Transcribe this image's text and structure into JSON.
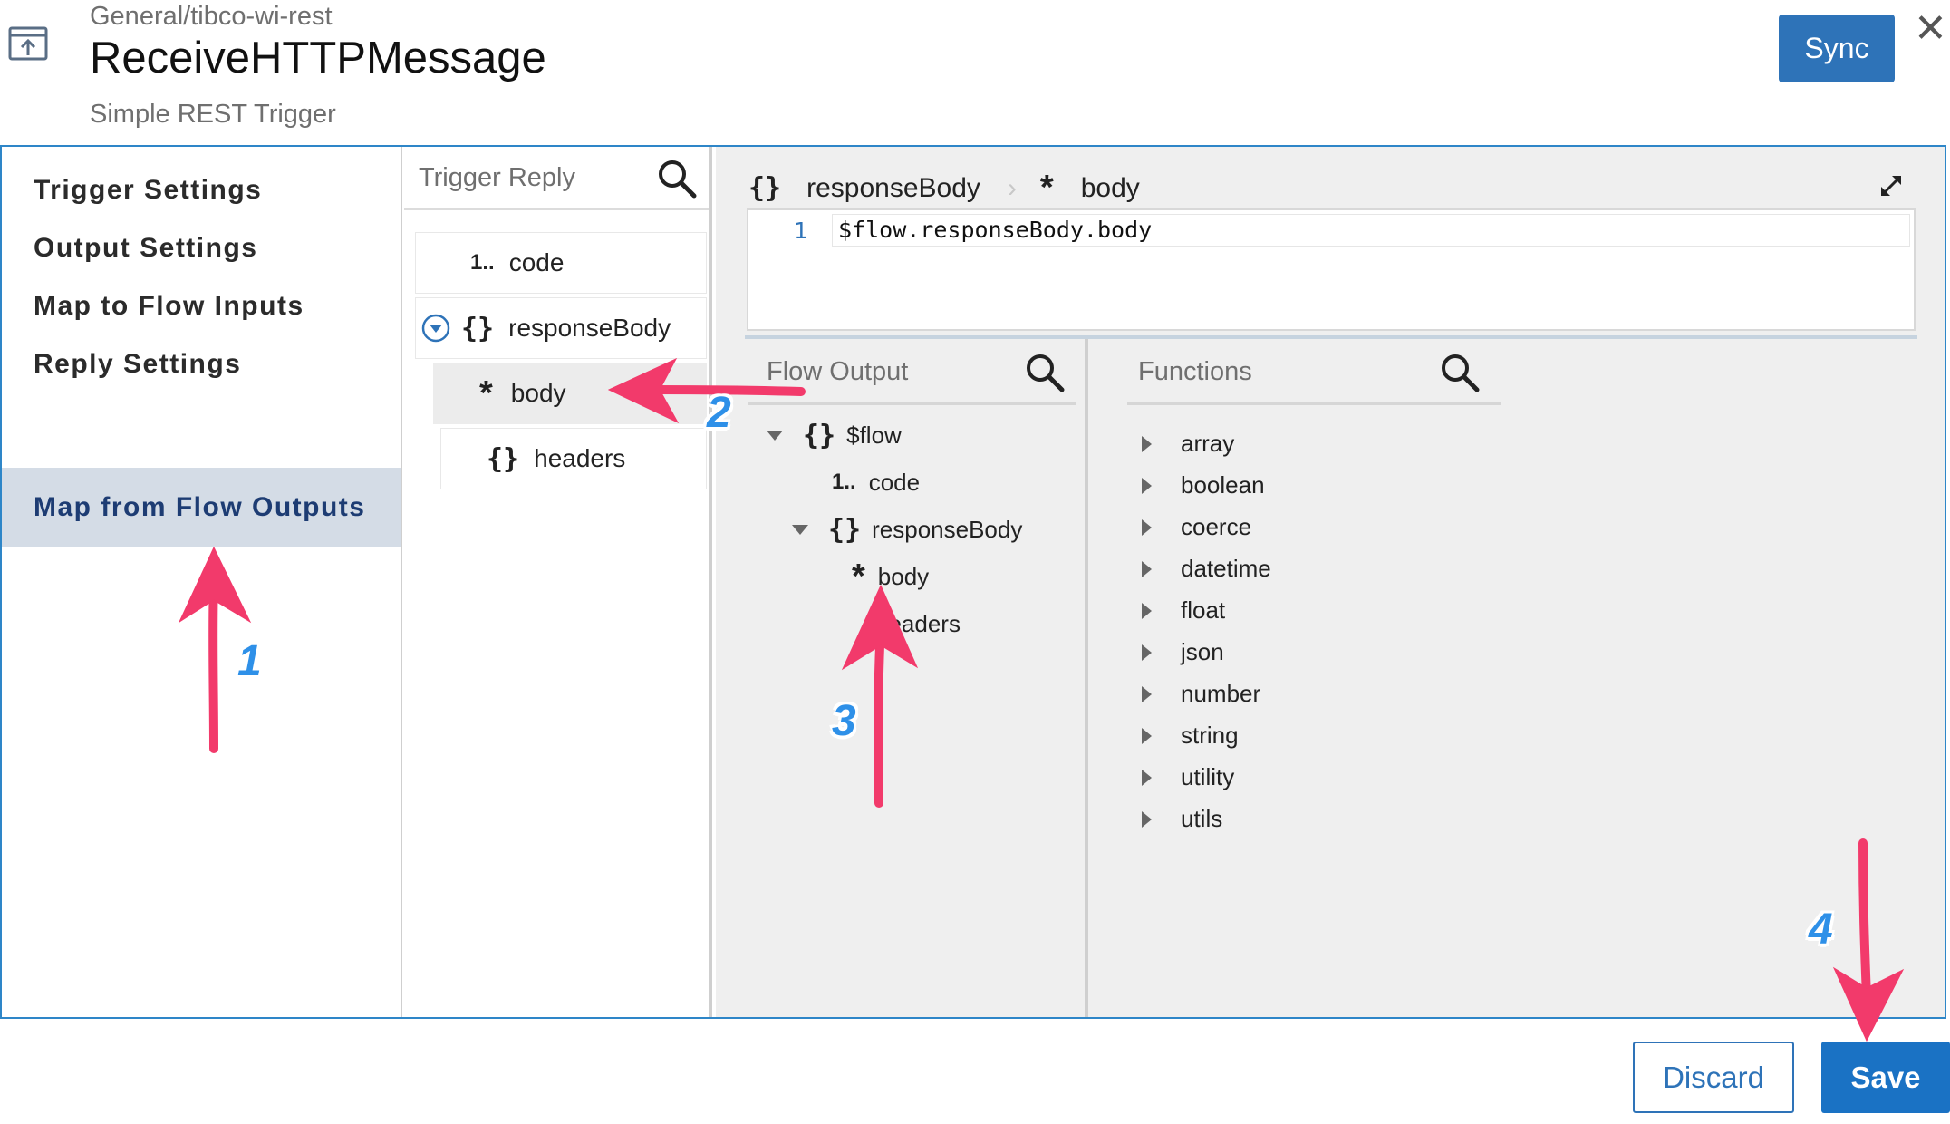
{
  "header": {
    "breadcrumb": "General/tibco-wi-rest",
    "title": "ReceiveHTTPMessage",
    "subtitle": "Simple REST Trigger",
    "sync_label": "Sync",
    "close_label": "✕",
    "icon": "trigger-icon"
  },
  "nav": {
    "items": [
      {
        "label": "Trigger Settings",
        "active": false
      },
      {
        "label": "Output Settings",
        "active": false
      },
      {
        "label": "Map to Flow Inputs",
        "active": false
      },
      {
        "label": "Reply Settings",
        "active": false
      },
      {
        "label": "Map from Flow Outputs",
        "active": true
      }
    ]
  },
  "trigger_reply": {
    "title": "Trigger Reply",
    "items": [
      {
        "icon": "1..",
        "label": "code",
        "type": "number"
      },
      {
        "icon": "{}",
        "label": "responseBody",
        "type": "object",
        "expanded": true
      },
      {
        "icon": "*",
        "label": "body",
        "type": "any",
        "selected": true
      },
      {
        "icon": "{}",
        "label": "headers",
        "type": "object"
      }
    ]
  },
  "mapper": {
    "path": [
      {
        "icon": "{}",
        "label": "responseBody"
      },
      {
        "icon": "*",
        "label": "body"
      }
    ],
    "path_separator": "›",
    "line_number": "1",
    "expression": "$flow.responseBody.body"
  },
  "flow_output": {
    "title": "Flow Output",
    "items": [
      {
        "icon": "{}",
        "label": "$flow",
        "expanded": true
      },
      {
        "icon": "1..",
        "label": "code"
      },
      {
        "icon": "{}",
        "label": "responseBody",
        "expanded": true
      },
      {
        "icon": "*",
        "label": "body"
      },
      {
        "icon": "",
        "label": "headers"
      }
    ]
  },
  "functions": {
    "title": "Functions",
    "items": [
      "array",
      "boolean",
      "coerce",
      "datetime",
      "float",
      "json",
      "number",
      "string",
      "utility",
      "utils"
    ]
  },
  "footer": {
    "discard_label": "Discard",
    "save_label": "Save"
  },
  "annotations": {
    "labels": [
      "1",
      "2",
      "3",
      "4"
    ],
    "color": "#f23a6b"
  },
  "colors": {
    "accent": "#2e73b8",
    "active_nav_bg": "#d4dce6",
    "frame_border": "#2e86c8"
  }
}
